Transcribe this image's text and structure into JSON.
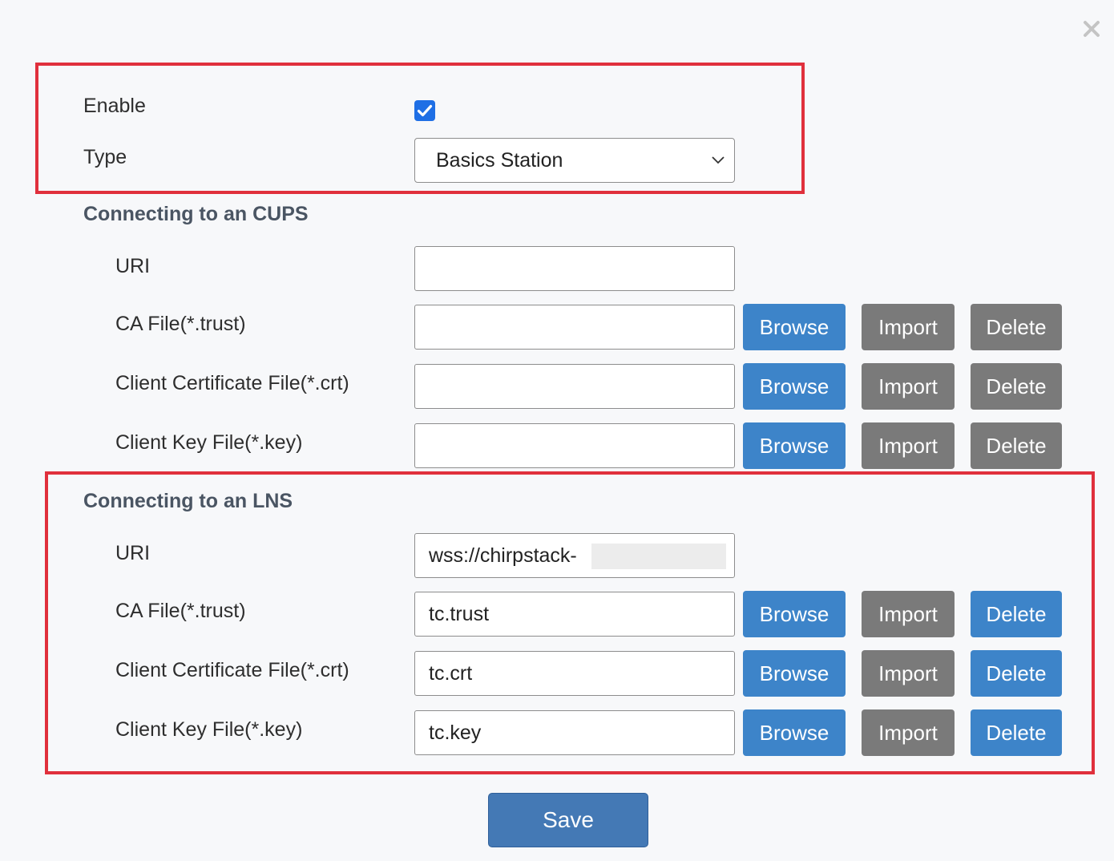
{
  "dialog": {
    "close_icon": "close-icon"
  },
  "general": {
    "enable_label": "Enable",
    "enable_checked": true,
    "type_label": "Type",
    "type_value": "Basics Station"
  },
  "cups": {
    "title": "Connecting to an CUPS",
    "uri_label": "URI",
    "uri_value": "",
    "ca_label": "CA File(*.trust)",
    "ca_value": "",
    "cert_label": "Client Certificate File(*.crt)",
    "cert_value": "",
    "key_label": "Client Key File(*.key)",
    "key_value": ""
  },
  "lns": {
    "title": "Connecting to an LNS",
    "uri_label": "URI",
    "uri_value": "wss://chirpstack-",
    "ca_label": "CA File(*.trust)",
    "ca_value": "tc.trust",
    "cert_label": "Client Certificate File(*.crt)",
    "cert_value": "tc.crt",
    "key_label": "Client Key File(*.key)",
    "key_value": "tc.key"
  },
  "buttons": {
    "browse": "Browse",
    "import": "Import",
    "delete": "Delete",
    "save": "Save"
  },
  "colors": {
    "primary_blue": "#3d84c9",
    "disabled_gray": "#7a7a7a",
    "highlight_red": "#e0303c",
    "checkbox_blue": "#1f6fe5"
  }
}
